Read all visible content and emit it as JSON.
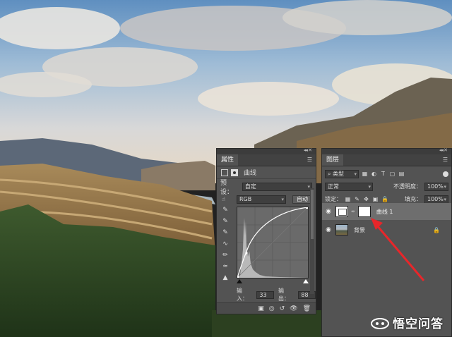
{
  "properties_panel": {
    "tab_label": "属性",
    "title": "曲线",
    "preset_label": "预设：",
    "preset_value": "自定",
    "channel_value": "RGB",
    "auto_button": "自动",
    "input_label": "输入：",
    "input_value": "33",
    "output_label": "输出：",
    "output_value": "88",
    "curve_point": {
      "input": 33,
      "output": 88
    }
  },
  "layers_panel": {
    "tab_label": "图层",
    "filter_kind": "类型",
    "blend_mode": "正常",
    "opacity_label": "不透明度：",
    "opacity_value": "100%",
    "lock_label": "锁定：",
    "fill_label": "填充：",
    "fill_value": "100%",
    "layers": [
      {
        "name": "曲线 1",
        "type": "curves-adjustment",
        "selected": true,
        "visible": true
      },
      {
        "name": "背景",
        "type": "image",
        "selected": false,
        "visible": true,
        "locked": true
      }
    ]
  },
  "watermark": {
    "text": "悟空问答"
  },
  "colors": {
    "panel_bg": "#535353",
    "selected_layer": "#6e6e6e",
    "annotation_arrow": "#e8262a"
  }
}
